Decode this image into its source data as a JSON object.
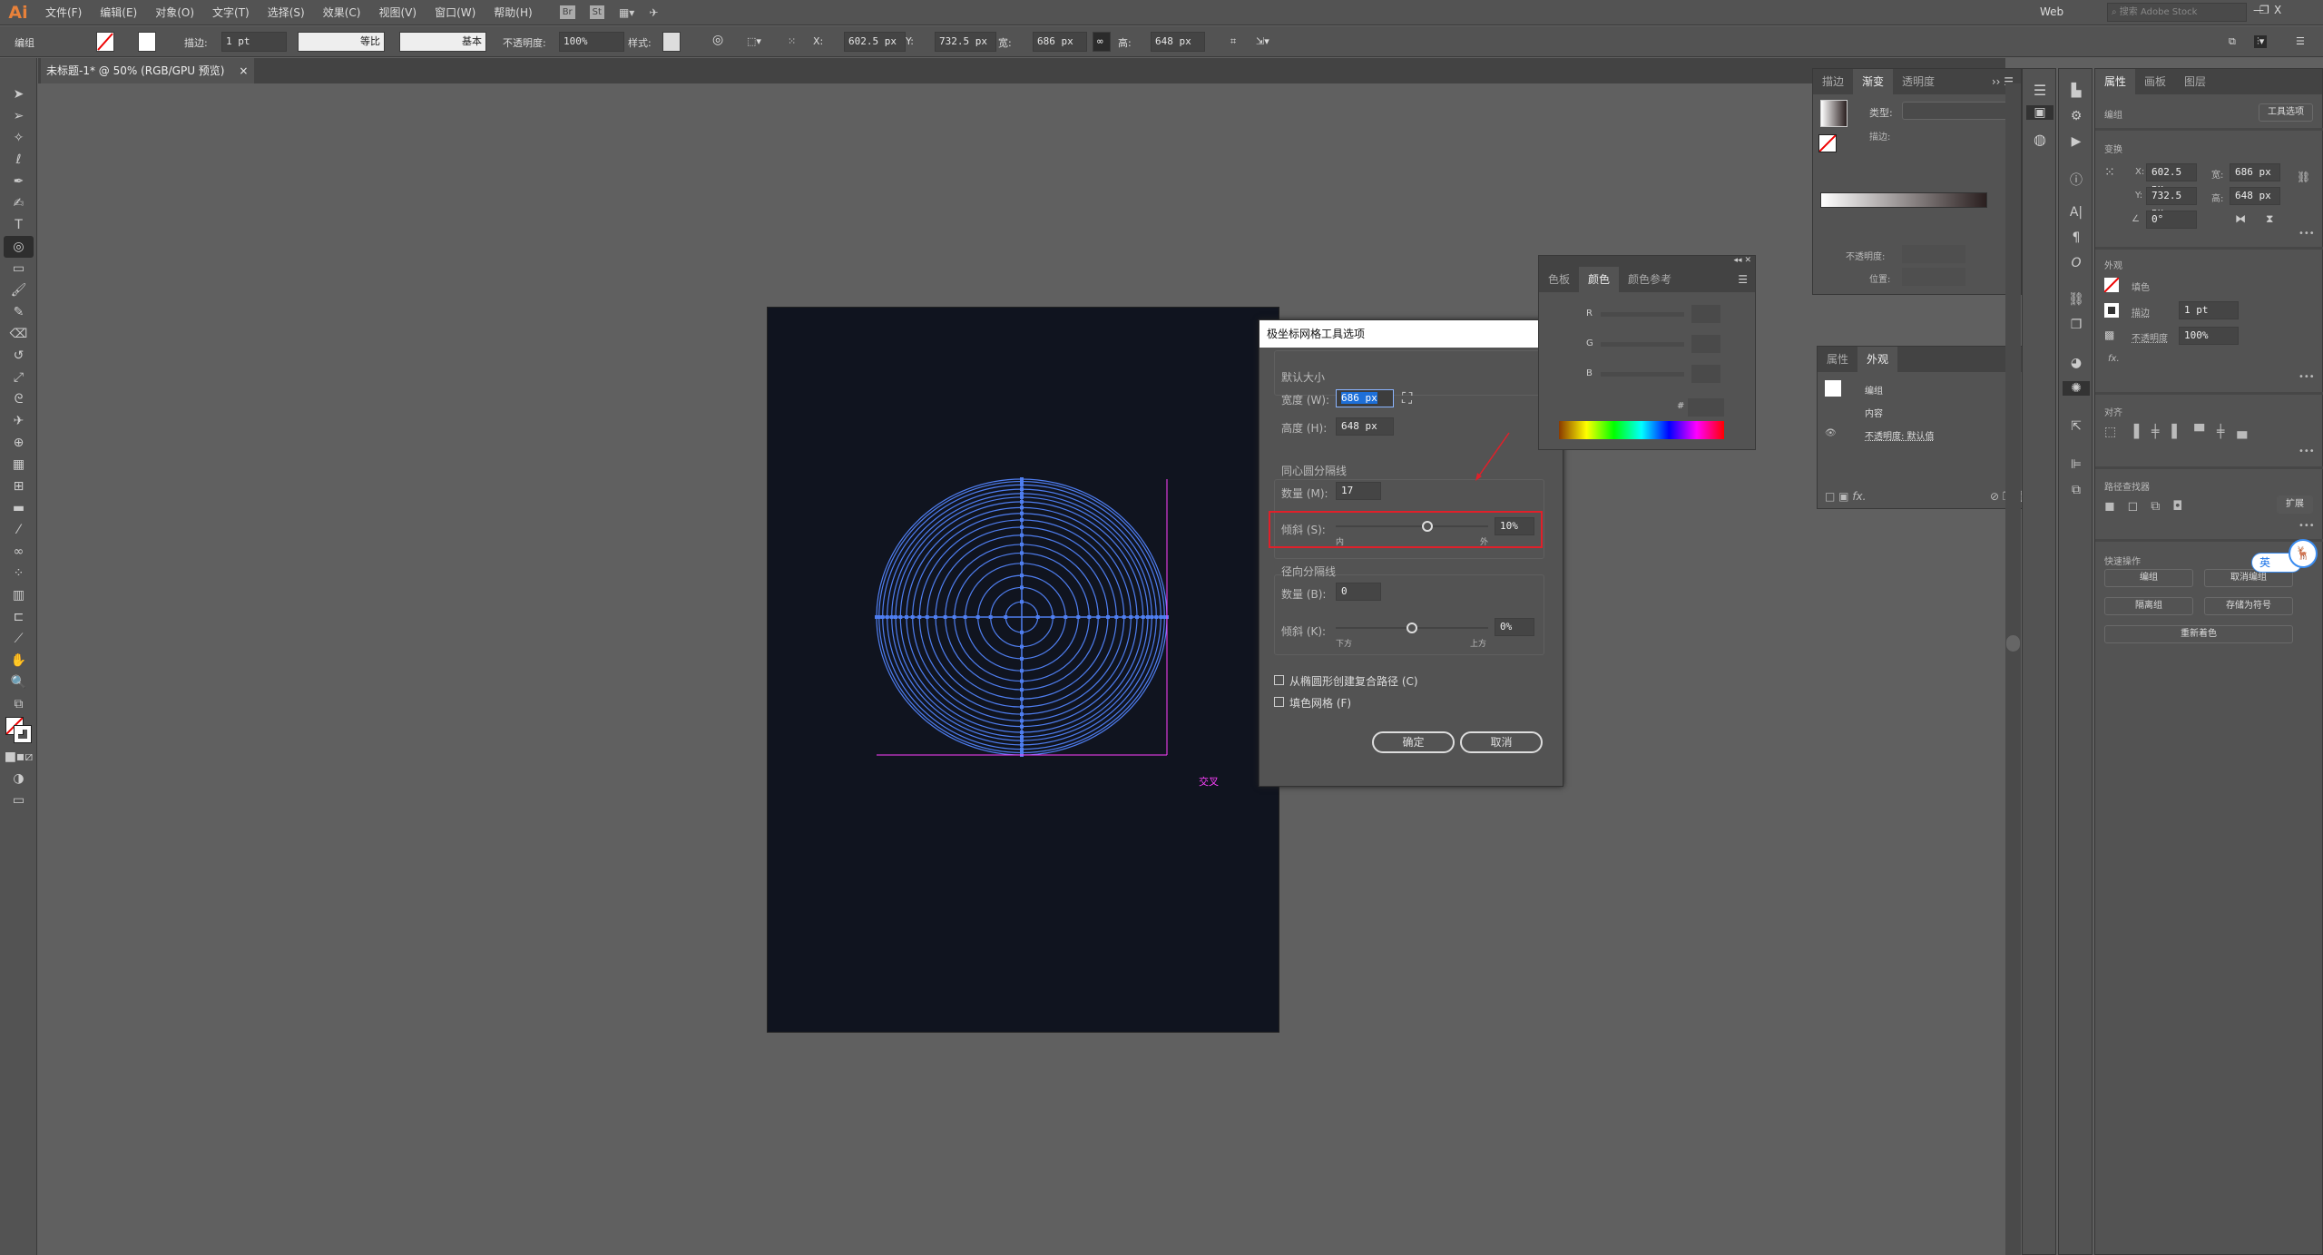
{
  "app": {
    "logo": "Ai",
    "menus": [
      "文件(F)",
      "编辑(E)",
      "对象(O)",
      "文字(T)",
      "选择(S)",
      "效果(C)",
      "视图(V)",
      "窗口(W)",
      "帮助(H)"
    ],
    "bridge": "Br",
    "stock": "St",
    "workspace": "Web",
    "search_placeholder": "搜索 Adobe Stock",
    "minimize": "—",
    "restore": "❐",
    "close": "X"
  },
  "control": {
    "selection": "编组",
    "stroke_label": "描边:",
    "stroke_weight": "1 pt",
    "profile": "等比",
    "brush": "基本",
    "opacity_label": "不透明度:",
    "opacity": "100%",
    "style_label": "样式:",
    "x_label": "X:",
    "x": "602.5 px",
    "y_label": "Y:",
    "y": "732.5 px",
    "w_label": "宽:",
    "w": "686 px",
    "h_label": "高:",
    "h": "648 px"
  },
  "document": {
    "tab": "未标题-1* @ 50% (RGB/GPU 预览)",
    "close": "×",
    "smart_guide": "交叉",
    "artboard_color": "#10141f",
    "grid_color": "#4f7ef0",
    "guide_color": "#ff40ff"
  },
  "dialog": {
    "title": "极坐标网格工具选项",
    "default_size": "默认大小",
    "width_label": "宽度 (W):",
    "width": "686 px",
    "height_label": "高度 (H):",
    "height": "648 px",
    "concentric": "同心圆分隔线",
    "conc_count_label": "数量 (M):",
    "conc_count": "17",
    "conc_skew_label": "倾斜 (S):",
    "conc_skew": "10%",
    "conc_skew_fraction": 0.6,
    "inner": "内",
    "outer": "外",
    "radial": "径向分隔线",
    "rad_count_label": "数量 (B):",
    "rad_count": "0",
    "rad_skew_label": "倾斜 (K):",
    "rad_skew": "0%",
    "rad_skew_fraction": 0.5,
    "bottom": "下方",
    "top": "上方",
    "compound": "从椭圆形创建复合路径 (C)",
    "compound_checked": false,
    "fill": "填色网格 (F)",
    "fill_checked": false,
    "ok": "确定",
    "cancel": "取消",
    "highlight_color": "#e0202a"
  },
  "gradient_panel": {
    "tabs": [
      "描边",
      "渐变",
      "透明度"
    ],
    "active": "渐变",
    "type_label": "类型:",
    "stroke_label": "描边:",
    "opacity_label": "不透明度:",
    "location_label": "位置:"
  },
  "color_panel": {
    "tabs": [
      "色板",
      "颜色",
      "颜色参考"
    ],
    "active": "颜色",
    "r": "R",
    "g": "G",
    "b": "B",
    "hex": "#"
  },
  "appearance_panel": {
    "tabs": [
      "属性",
      "外观"
    ],
    "active": "外观",
    "rows": [
      "编组",
      "内容",
      "不透明度: 默认值"
    ]
  },
  "properties": {
    "tabs": [
      "属性",
      "画板",
      "图层"
    ],
    "active": "属性",
    "selection": "编组",
    "tool_options": "工具选项",
    "transform": "变换",
    "x_label": "X:",
    "x": "602.5 px",
    "y_label": "Y:",
    "y": "732.5 px",
    "w_label": "宽:",
    "w": "686 px",
    "h_label": "高:",
    "h": "648 px",
    "angle": "0°",
    "appearance": "外观",
    "fill": "填色",
    "stroke": "描边",
    "stroke_weight": "1 pt",
    "opacity_label": "不透明度",
    "opacity": "100%",
    "fx": "fx.",
    "align": "对齐",
    "pathfinder": "路径查找器",
    "expand": "扩展",
    "quick_actions": "快速操作",
    "buttons": [
      "编组",
      "取消编组",
      "隔离组",
      "存储为符号",
      "重新着色"
    ],
    "ime": "英",
    "more": "•••"
  }
}
